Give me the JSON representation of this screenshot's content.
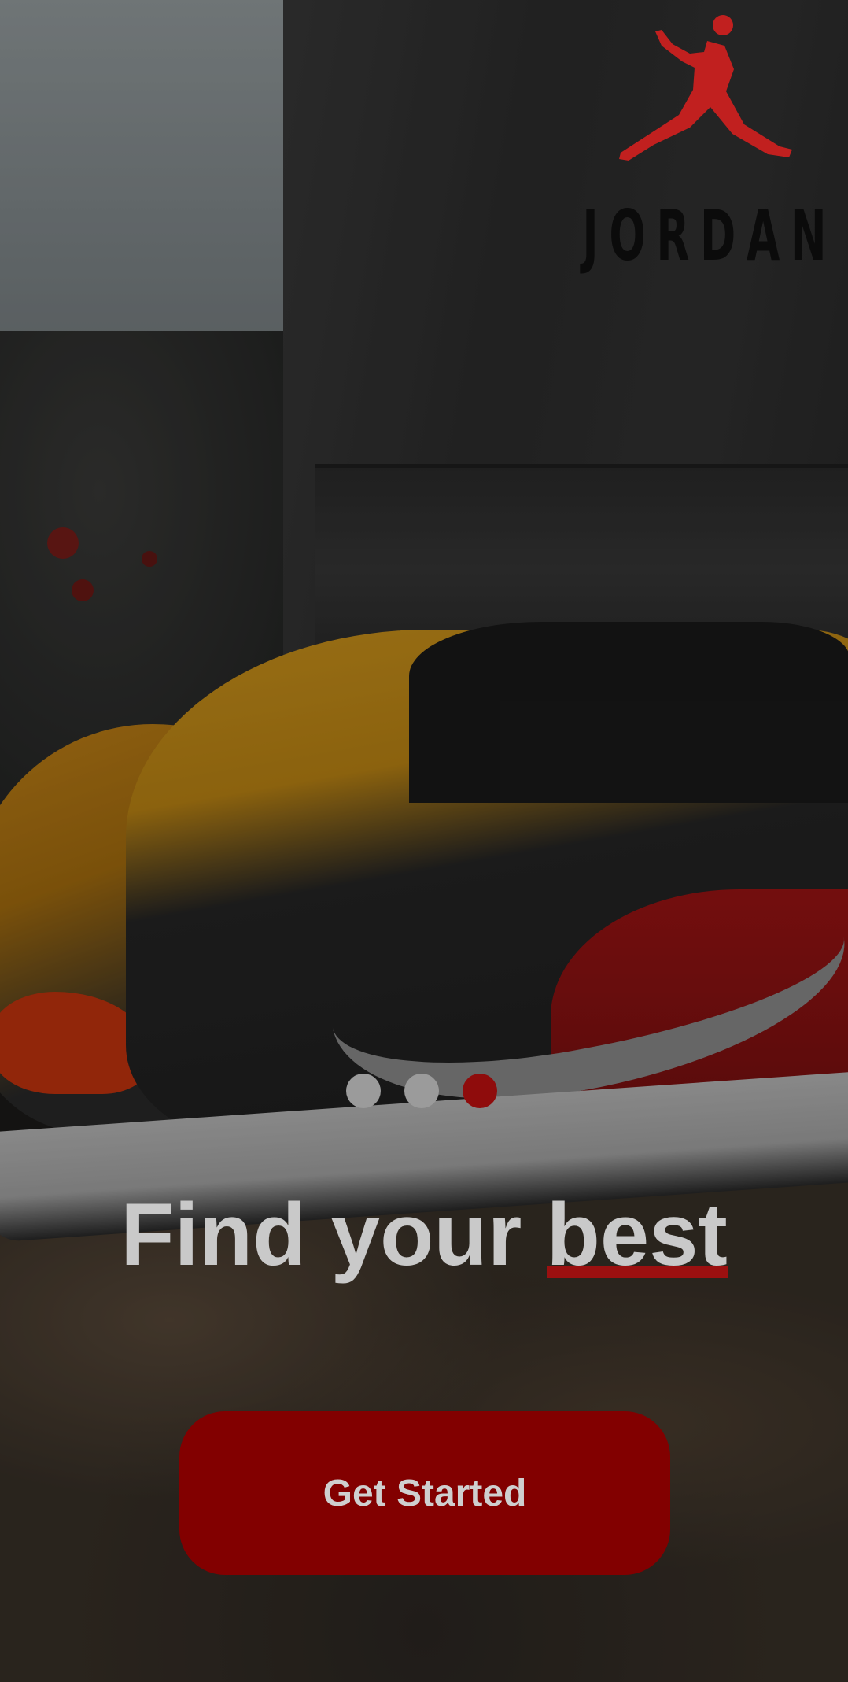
{
  "brand": {
    "name": "JORDAN",
    "logo_icon": "jumpman-icon",
    "logo_color": "#c1201f"
  },
  "pagination": {
    "total": 3,
    "active_index": 2,
    "active_color": "#8f0c0c",
    "inactive_color": "#9b9b9b"
  },
  "headline": {
    "prefix": "Find your ",
    "highlight": "best",
    "highlight_underline_color": "#9b1010"
  },
  "cta": {
    "label": "Get Started",
    "color": "#820000"
  }
}
